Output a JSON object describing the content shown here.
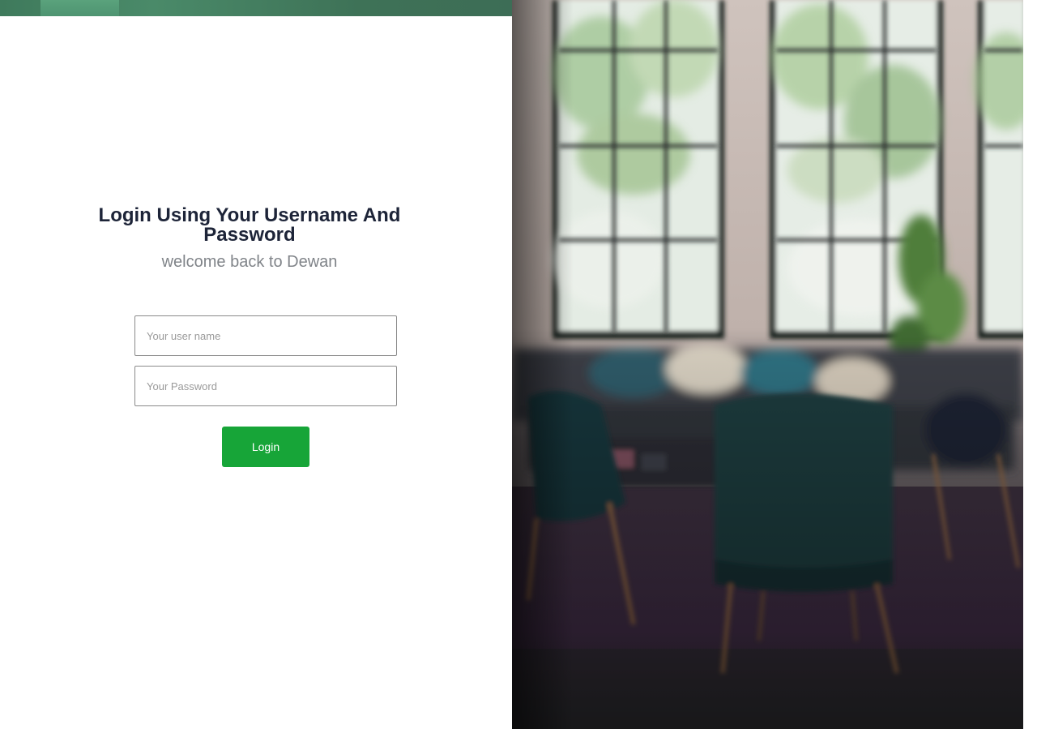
{
  "login": {
    "heading": "Login Using Your Username And Password",
    "subheading": "welcome back to Dewan",
    "username_placeholder": "Your user name",
    "password_placeholder": "Your Password",
    "login_button_label": "Login"
  },
  "colors": {
    "accent_green": "#17a538",
    "top_strip_green": "#3f7a5c",
    "heading_text": "#1d2438",
    "subheading_text": "#808489"
  },
  "background_image": {
    "subject": "blurred-living-room-with-windows-and-chairs"
  }
}
